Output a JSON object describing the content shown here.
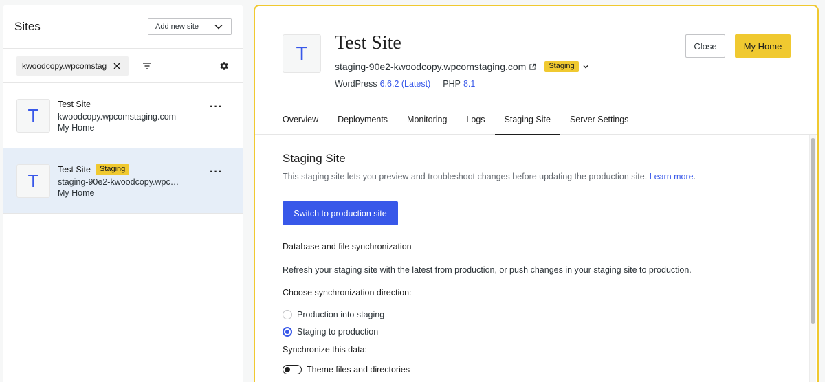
{
  "sidebar": {
    "title": "Sites",
    "add_button_label": "Add new site",
    "search_value": "kwoodcopy.wpcomstag",
    "sites": [
      {
        "avatar_letter": "T",
        "name": "Test Site",
        "url": "kwoodcopy.wpcomstaging.com",
        "home_label": "My Home",
        "badge": ""
      },
      {
        "avatar_letter": "T",
        "name": "Test Site",
        "url": "staging-90e2-kwoodcopy.wpcomstaging.com",
        "home_label": "My Home",
        "badge": "Staging"
      }
    ]
  },
  "panel": {
    "avatar_letter": "T",
    "title": "Test Site",
    "url": "staging-90e2-kwoodcopy.wpcomstaging.com",
    "badge": "Staging",
    "wp_label": "WordPress",
    "wp_version": "6.6.2 (Latest)",
    "php_label": "PHP",
    "php_version": "8.1",
    "close_label": "Close",
    "home_label": "My Home",
    "tabs": [
      "Overview",
      "Deployments",
      "Monitoring",
      "Logs",
      "Staging Site",
      "Server Settings"
    ],
    "active_tab": "Staging Site"
  },
  "content": {
    "title": "Staging Site",
    "description": "This staging site lets you preview and troubleshoot changes before updating the production site.",
    "learn_more": "Learn more",
    "switch_button": "Switch to production site",
    "sync_heading": "Database and file synchronization",
    "sync_paragraph": "Refresh your staging site with the latest from production, or push changes in your staging site to production.",
    "choose_direction": "Choose synchronization direction:",
    "radio_options": [
      "Production into staging",
      "Staging to production"
    ],
    "selected_option": "Staging to production",
    "sync_data_label": "Synchronize this data:",
    "toggle_label": "Theme files and directories"
  },
  "colors": {
    "accent": "#3858e9",
    "badge": "#f0c930",
    "selected_row": "#e6eef8"
  }
}
